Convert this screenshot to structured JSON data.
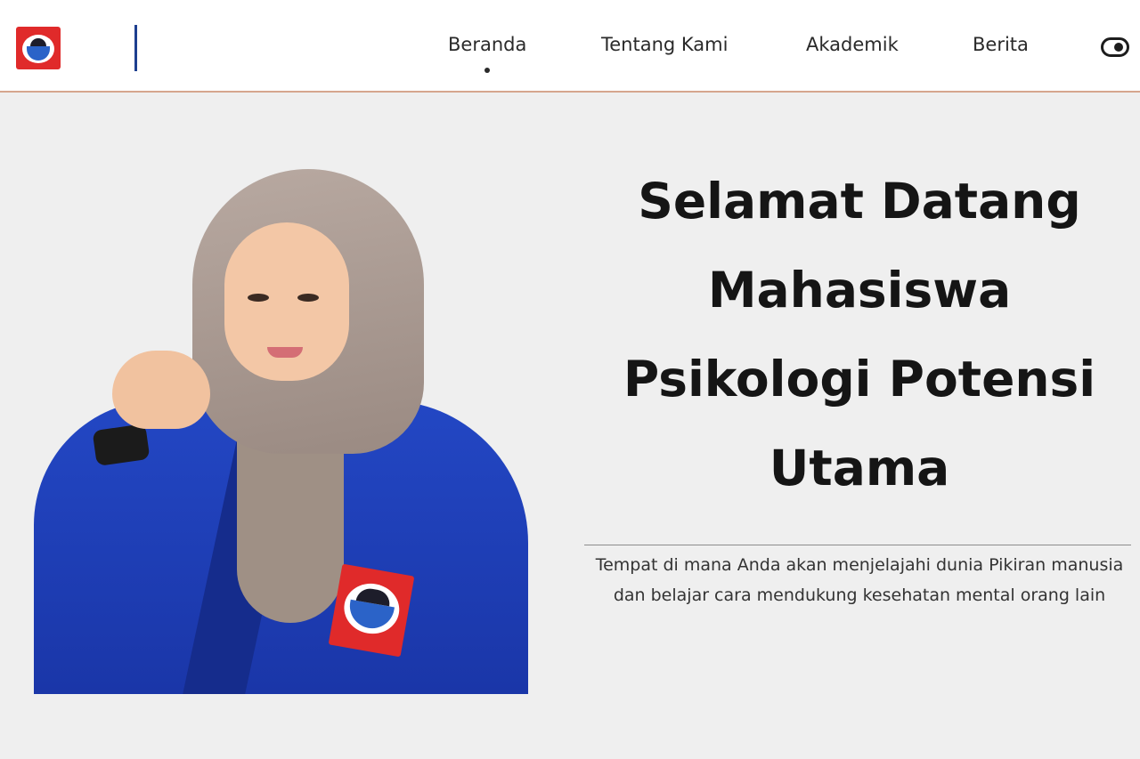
{
  "brand": {
    "logo_small_text": "",
    "logo_name": ""
  },
  "nav": {
    "items": [
      {
        "label": "Beranda",
        "active": true
      },
      {
        "label": "Tentang Kami",
        "active": false
      },
      {
        "label": "Akademik",
        "active": false
      },
      {
        "label": "Berita",
        "active": false
      }
    ],
    "theme_toggle_icon": "toggle-icon"
  },
  "hero": {
    "title_lines": [
      "Selamat Datang",
      "Mahasiswa",
      "Psikologi Potensi",
      "Utama"
    ],
    "description": "Tempat di mana Anda akan menjelajahi dunia Pikiran manusia dan belajar cara mendukung kesehatan mental orang lain",
    "image_name": "student-photo"
  },
  "colors": {
    "brand_red": "#e02a2a",
    "brand_blue": "#2347c4",
    "nav_border": "#d6a68e",
    "background": "#efefef"
  }
}
